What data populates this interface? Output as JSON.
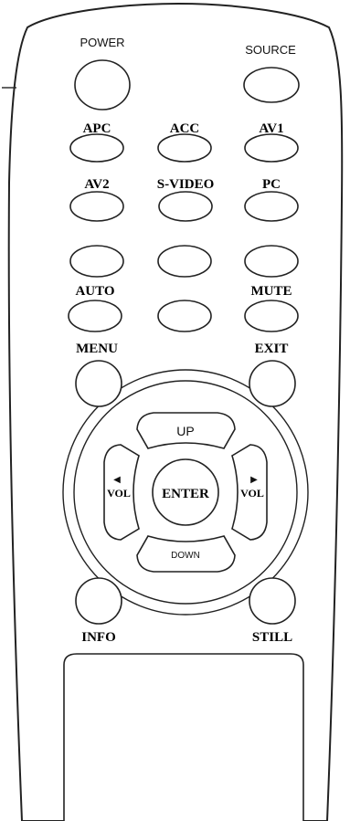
{
  "remote": {
    "power_label": "POWER",
    "source_label": "SOURCE",
    "apc_label": "APC",
    "acc_label": "ACC",
    "av1_label": "AV1",
    "av2_label": "AV2",
    "svideo_label": "S-VIDEO",
    "pc_label": "PC",
    "auto_label": "AUTO",
    "mute_label": "MUTE",
    "menu_label": "MENU",
    "exit_label": "EXIT",
    "up_label": "UP",
    "down_label": "DOWN",
    "enter_label": "ENTER",
    "vol_left_label": "VOL",
    "vol_right_label": "VOL",
    "vol_left_arrow": "◀",
    "vol_right_arrow": "▶",
    "info_label": "INFO",
    "still_label": "STILL"
  }
}
